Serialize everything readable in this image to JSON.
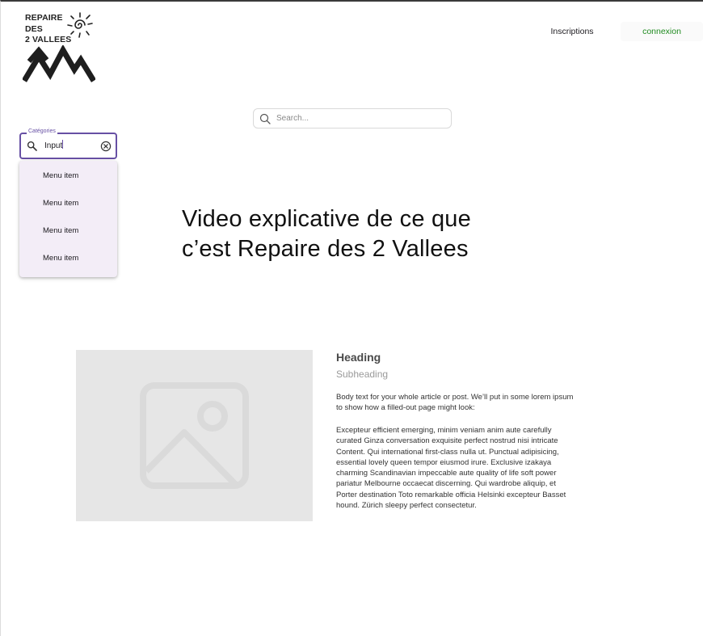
{
  "logo": {
    "lines": [
      "REPAIRE",
      "DES",
      "2 VALLEES"
    ]
  },
  "nav": {
    "inscriptions": "Inscriptions",
    "connexion": "connexion"
  },
  "search": {
    "placeholder": "Search..."
  },
  "categories": {
    "label": "Catégories",
    "value": "Input",
    "menu_items": [
      "Menu item",
      "Menu item",
      "Menu item",
      "Menu item"
    ]
  },
  "hero": {
    "line1": "Video explicative de ce que",
    "line2": "c’est Repaire des 2 Vallees"
  },
  "article": {
    "heading": "Heading",
    "subheading": "Subheading",
    "intro": "Body text for your whole article or post. We’ll put in some lorem ipsum to show how a filled-out page might look:",
    "body": "Excepteur efficient emerging, minim veniam anim aute carefully curated Ginza conversation exquisite perfect nostrud nisi intricate Content. Qui  international first-class nulla ut. Punctual adipisicing, essential lovely queen tempor eiusmod irure. Exclusive izakaya charming Scandinavian impeccable aute quality of life soft power pariatur Melbourne occaecat discerning. Qui wardrobe aliquip, et Porter destination Toto remarkable officia Helsinki excepteur Basset hound. Zürich sleepy perfect consectetur."
  },
  "colors": {
    "accent": "#6750a4",
    "connexion_text": "#1f8a1f",
    "menu_bg": "#f3edf7",
    "image_placeholder": "#e6e6e6"
  },
  "icons": {
    "logo_sun": "sun-spiral-icon",
    "logo_mountains": "mountains-icon",
    "search": "search-icon",
    "clear": "clear-circle-icon",
    "image": "image-placeholder-icon"
  }
}
